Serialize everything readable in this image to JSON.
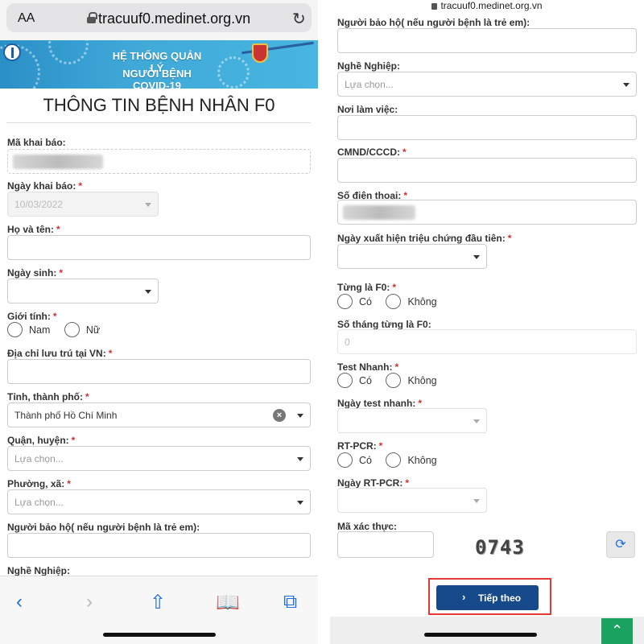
{
  "browser": {
    "text_size_label": "AA",
    "url": "tracuuf0.medinet.org.vn",
    "reload_icon": "reload-icon"
  },
  "banner": {
    "line1": "HỆ THỐNG QUẢN LÝ",
    "line2": "NGƯỜI BỆNH COVID-19"
  },
  "page_title": "THÔNG TIN BỆNH NHÂN F0",
  "required_mark": "*",
  "left_form": {
    "ma_khai_bao": {
      "label": "Mã khai báo:"
    },
    "ngay_khai_bao": {
      "label": "Ngày khai báo:",
      "value": "10/03/2022"
    },
    "ho_va_ten": {
      "label": "Họ và tên:"
    },
    "ngay_sinh": {
      "label": "Ngày sinh:"
    },
    "gioi_tinh": {
      "label": "Giới tính:",
      "options": [
        "Nam",
        "Nữ"
      ]
    },
    "dia_chi": {
      "label": "Địa chỉ lưu trú tại VN:"
    },
    "tinh_thanh": {
      "label": "Tỉnh, thành phố:",
      "value": "Thành phố Hồ Chí Minh"
    },
    "quan_huyen": {
      "label": "Quận, huyện:",
      "placeholder": "Lựa chọn..."
    },
    "phuong_xa": {
      "label": "Phường, xã:",
      "placeholder": "Lựa chọn..."
    },
    "nguoi_bao_ho": {
      "label": "Người bảo hộ( nếu người bệnh là trẻ em):"
    },
    "nghe_nghiep": {
      "label": "Nghề Nghiệp:"
    }
  },
  "right_form": {
    "nguoi_bao_ho": {
      "label": "Người bảo hộ( nếu người bệnh là trẻ em):"
    },
    "nghe_nghiep": {
      "label": "Nghề Nghiệp:",
      "placeholder": "Lựa chọn..."
    },
    "noi_lam_viec": {
      "label": "Nơi làm việc:"
    },
    "cmnd": {
      "label": "CMND/CCCD:"
    },
    "so_dien_thoai": {
      "label": "Số điện thoại:"
    },
    "ngay_trieu_chung": {
      "label": "Ngày xuất hiện triệu chứng đầu tiên:"
    },
    "tung_la_f0": {
      "label": "Từng là F0:",
      "options": [
        "Có",
        "Không"
      ]
    },
    "so_thang_f0": {
      "label": "Số tháng từng là F0:",
      "placeholder": "0"
    },
    "test_nhanh": {
      "label": "Test Nhanh:",
      "options": [
        "Có",
        "Không"
      ]
    },
    "ngay_test_nhanh": {
      "label": "Ngày test nhanh:"
    },
    "rt_pcr": {
      "label": "RT-PCR:",
      "options": [
        "Có",
        "Không"
      ]
    },
    "ngay_rt_pcr": {
      "label": "Ngày RT-PCR:"
    },
    "ma_xac_thuc": {
      "label": "Mã xác thực:",
      "captcha": "0743"
    },
    "submit_label": "Tiếp theo"
  },
  "toolbar": {
    "icons": [
      "back-icon",
      "forward-icon",
      "share-icon",
      "bookmarks-icon",
      "tabs-icon"
    ]
  },
  "colors": {
    "primary_button": "#174a8b",
    "highlight_box": "#e53935",
    "scroll_top_button": "#1aa260",
    "link_blue": "#1f6fdc",
    "required": "#d32f2f"
  }
}
